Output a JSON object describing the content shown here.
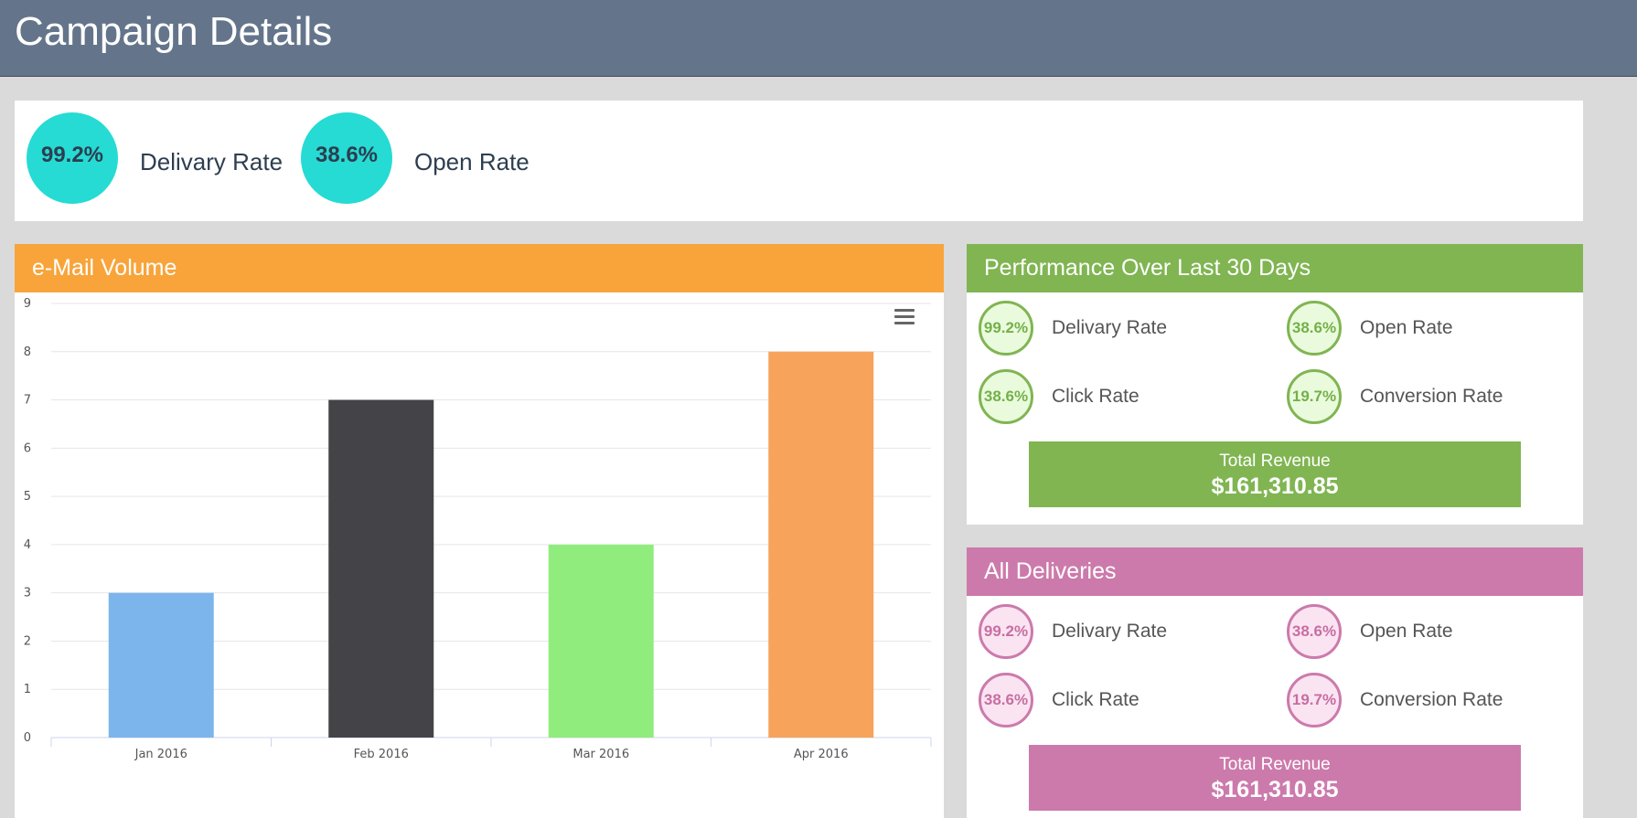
{
  "page": {
    "title": "Campaign Details"
  },
  "summary": {
    "items": [
      {
        "value": "99.2%",
        "label": "Delivary Rate"
      },
      {
        "value": "38.6%",
        "label": "Open Rate"
      }
    ],
    "circle_color": "#26dbd3"
  },
  "volume": {
    "title": "e-Mail Volume",
    "header_color": "#f8a43a",
    "menu_icon": "hamburger-menu-icon"
  },
  "chart_data": {
    "type": "bar",
    "title": "",
    "xlabel": "",
    "ylabel": "",
    "categories": [
      "Jan 2016",
      "Feb 2016",
      "Mar 2016",
      "Apr 2016"
    ],
    "values": [
      3,
      7,
      4,
      8
    ],
    "colors": [
      "#7cb5ec",
      "#434348",
      "#90ed7d",
      "#f7a35c"
    ],
    "ylim": [
      0,
      9
    ],
    "yticks": [
      "0",
      "1",
      "2",
      "3",
      "4",
      "5",
      "6",
      "7",
      "8",
      "9"
    ],
    "grid": true,
    "legend": "none"
  },
  "performance": {
    "title": "Performance Over Last 30 Days",
    "color": "#80b552",
    "metrics": [
      {
        "value": "99.2%",
        "label": "Delivary Rate"
      },
      {
        "value": "38.6%",
        "label": "Open Rate"
      },
      {
        "value": "38.6%",
        "label": "Click Rate"
      },
      {
        "value": "19.7%",
        "label": "Conversion Rate"
      }
    ],
    "revenue_label": "Total Revenue",
    "revenue_value": "$161,310.85"
  },
  "deliveries": {
    "title": "All Deliveries",
    "color": "#cc7aab",
    "metrics": [
      {
        "value": "99.2%",
        "label": "Delivary Rate"
      },
      {
        "value": "38.6%",
        "label": "Open Rate"
      },
      {
        "value": "38.6%",
        "label": "Click Rate"
      },
      {
        "value": "19.7%",
        "label": "Conversion Rate"
      }
    ],
    "revenue_label": "Total Revenue",
    "revenue_value": "$161,310.85"
  }
}
